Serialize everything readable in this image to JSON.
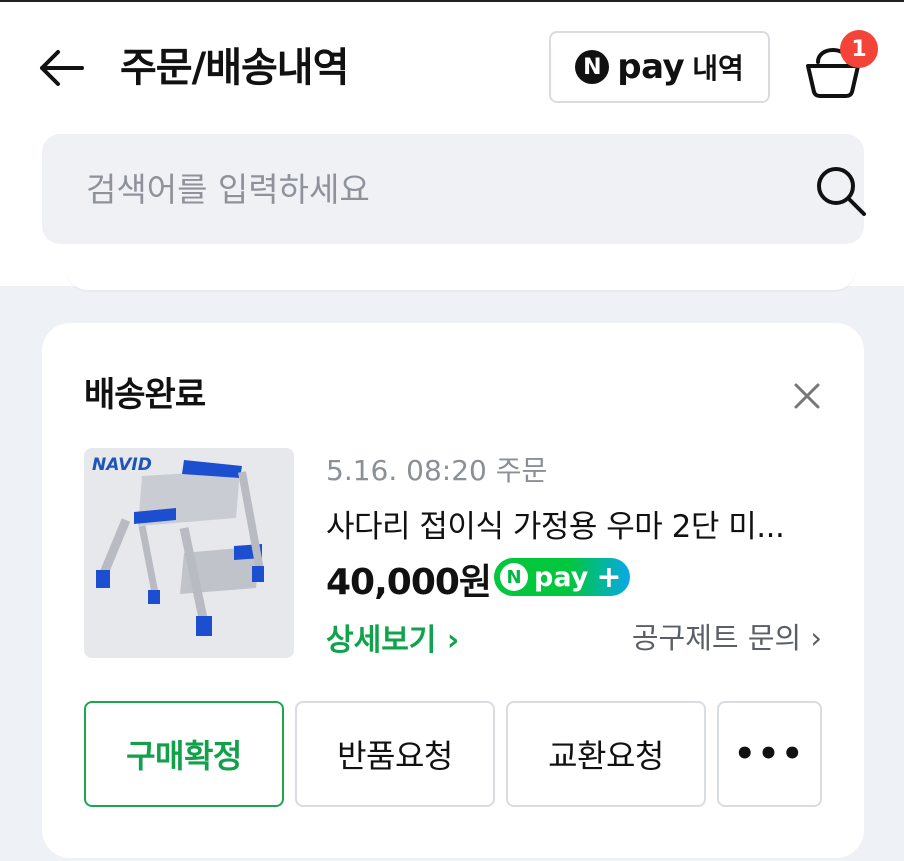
{
  "header": {
    "title": "주문/배송내역",
    "npay_button": {
      "n": "N",
      "pay": "pay",
      "label": "내역"
    },
    "cart_badge": "1"
  },
  "search": {
    "placeholder": "검색어를 입력하세요"
  },
  "order": {
    "status": "배송완료",
    "image_brand": "NAVID",
    "order_date": "5.16. 08:20 주문",
    "product_name": "사다리 접이식 가정용 우마 2단 미...",
    "price": "40,000원",
    "npay_badge": {
      "n": "N",
      "pay": "pay",
      "plus": "+"
    },
    "detail_link": "상세보기 ›",
    "inquiry_link": "공구제트 문의 ›",
    "buttons": {
      "confirm": "구매확정",
      "return": "반품요청",
      "exchange": "교환요청",
      "more": "•••"
    }
  },
  "colors": {
    "accent_green": "#13a04a",
    "badge_red": "#f4443a",
    "background": "#eef1f5"
  }
}
